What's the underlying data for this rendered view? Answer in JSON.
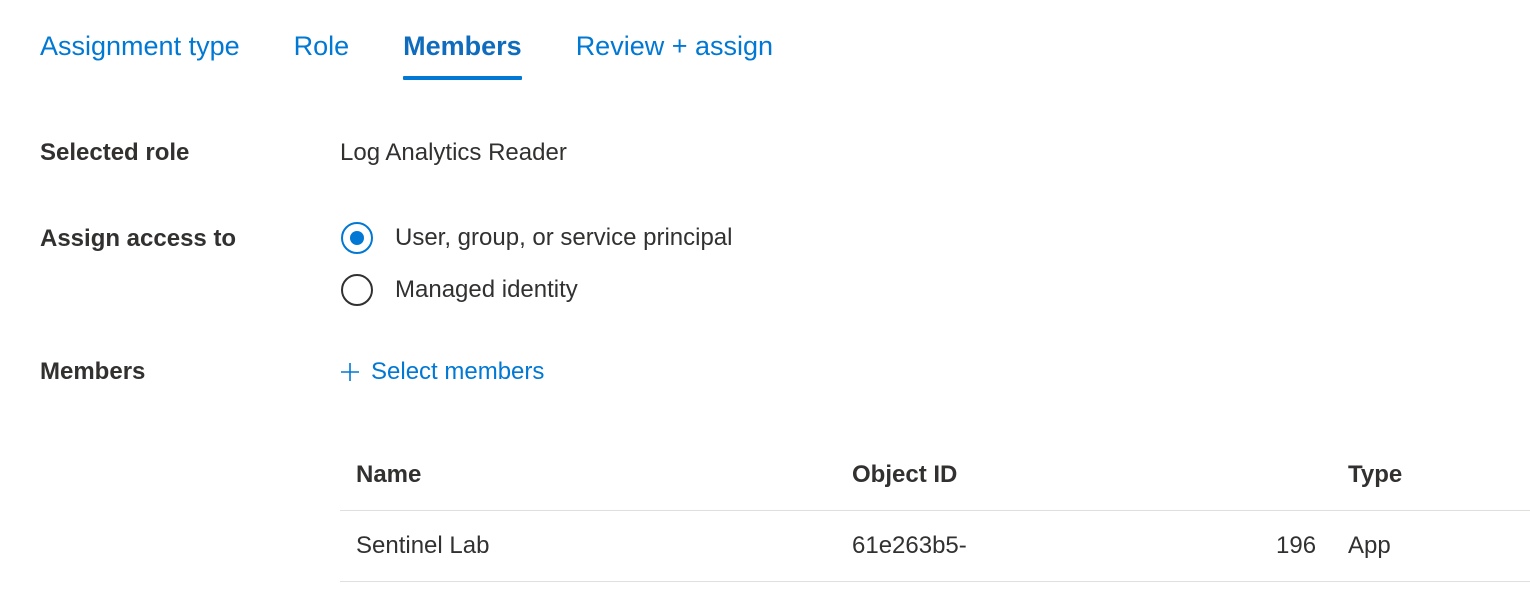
{
  "tabs": [
    {
      "label": "Assignment type",
      "active": false
    },
    {
      "label": "Role",
      "active": false
    },
    {
      "label": "Members",
      "active": true
    },
    {
      "label": "Review + assign",
      "active": false
    }
  ],
  "selected_role": {
    "label": "Selected role",
    "value": "Log Analytics Reader"
  },
  "assign_access": {
    "label": "Assign access to",
    "options": [
      {
        "label": "User, group, or service principal",
        "checked": true
      },
      {
        "label": "Managed identity",
        "checked": false
      }
    ]
  },
  "members": {
    "label": "Members",
    "select_link": "Select members",
    "select_icon": "plus-icon"
  },
  "table": {
    "headers": {
      "name": "Name",
      "object_id": "Object ID",
      "type": "Type"
    },
    "rows": [
      {
        "name": "Sentinel Lab",
        "object_id_start": "61e263b5-",
        "object_id_end": "196",
        "type": "App"
      }
    ]
  },
  "colors": {
    "accent": "#0078d4",
    "text": "#323130",
    "divider": "#e1dfdd"
  }
}
